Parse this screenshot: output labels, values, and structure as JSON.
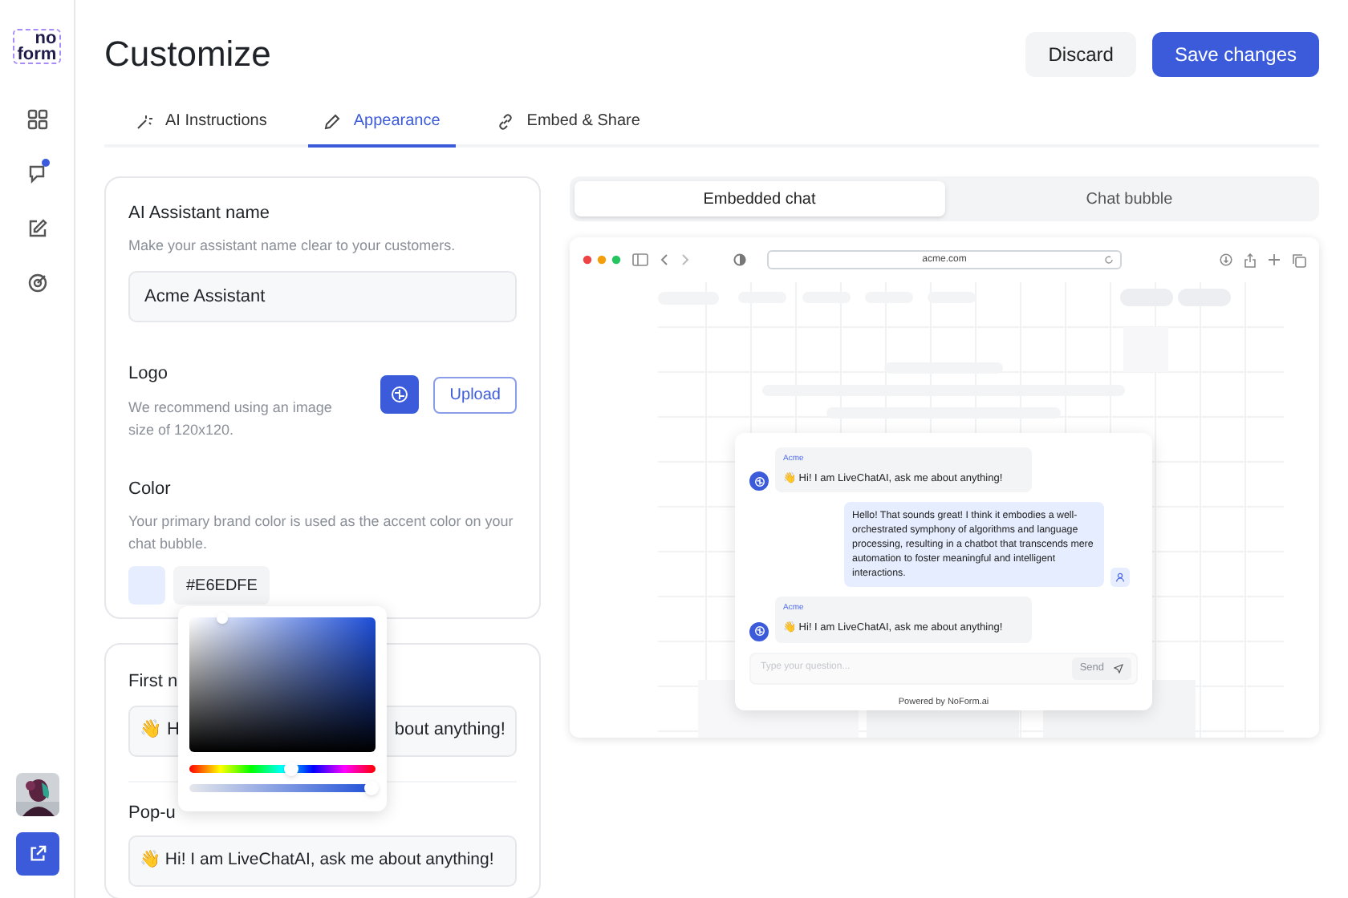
{
  "logo": {
    "lines": [
      "no",
      "form"
    ]
  },
  "sidebar": {
    "items": [
      {
        "kind": "grid",
        "notification": false
      },
      {
        "kind": "chat",
        "notification": true
      },
      {
        "kind": "edit",
        "notification": false
      },
      {
        "kind": "target",
        "notification": false
      }
    ]
  },
  "title": "Customize",
  "actions": [
    {
      "label": "Discard",
      "kind": "secondary"
    },
    {
      "label": "Save changes",
      "kind": "primary"
    }
  ],
  "tabs": [
    {
      "label": "AI Instructions",
      "selected": false
    },
    {
      "label": "Appearance",
      "selected": true
    },
    {
      "label": "Embed & Share",
      "selected": false
    }
  ],
  "settings": {
    "name": {
      "label": "AI Assistant name",
      "description": "Make your assistant name clear to your customers.",
      "value": "Acme Assistant"
    },
    "logo": {
      "label": "Logo",
      "description": "We recommend using an image size of 120x120.",
      "button": "Upload"
    },
    "color": {
      "label": "Color",
      "description": "Your primary brand color is used as the accent color on your chat bubble.",
      "value": "#E6EDFE"
    },
    "first_message": {
      "label": "First n",
      "value_start": "👋 H",
      "value_end": "bout anything!"
    },
    "popup_message": {
      "label": "Pop-u",
      "value": "👋 Hi! I am LiveChatAI, ask me about anything!"
    }
  },
  "color_picker": {
    "hue": {
      "level": 0.54
    },
    "alpha": {
      "level": 0.97
    }
  },
  "preview": {
    "modes": [
      {
        "label": "Embedded chat",
        "selected": true
      },
      {
        "label": "Chat bubble",
        "selected": false
      }
    ],
    "url": "acme.com",
    "messages": [
      {
        "kind": "bot",
        "sender": "Acme",
        "text": "👋 Hi! I am LiveChatAI, ask me about anything!"
      },
      {
        "kind": "user",
        "text": "Hello! That sounds great! I think it embodies a well-orchestrated symphony of algorithms and language processing, resulting in a chatbot that transcends mere automation to foster meaningful and intelligent interactions."
      },
      {
        "kind": "bot",
        "sender": "Acme",
        "text": "👋 Hi! I am LiveChatAI, ask me about anything!"
      }
    ],
    "input_placeholder": "Type your question...",
    "send": "Send",
    "footer": "Powered by NoForm.ai"
  }
}
